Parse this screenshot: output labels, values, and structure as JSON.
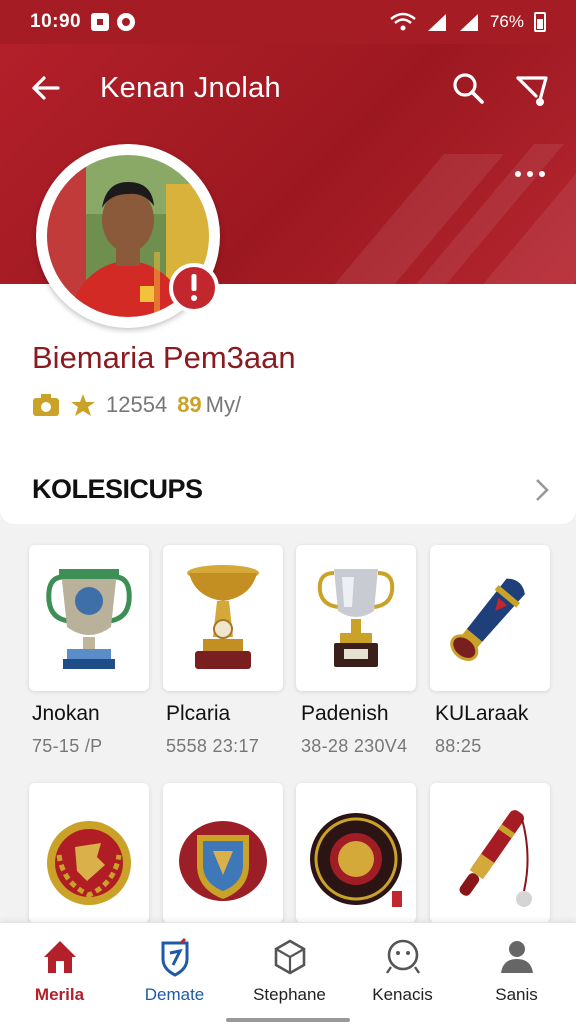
{
  "status_bar": {
    "time": "10:90",
    "battery": "76%"
  },
  "header": {
    "title": "Kenan Jnolah",
    "colors": {
      "primary": "#a51c24",
      "accent_gold": "#c9a227"
    },
    "icons": [
      "back-arrow-icon",
      "search-icon",
      "share-icon",
      "more-icon"
    ]
  },
  "profile": {
    "name": "Biemaria Pem3aan",
    "points": "12554",
    "count": "89",
    "count_unit": "My/"
  },
  "collection": {
    "title": "KOLESICUPS",
    "items": [
      {
        "name": "Jnokan",
        "meta": "75-15 /P",
        "icon": "green-trophy-icon"
      },
      {
        "name": "Plcaria",
        "meta": "5558 23:17",
        "icon": "gold-trophy-icon"
      },
      {
        "name": "Padenish",
        "meta": "38-28 230V4",
        "icon": "silver-cup-icon"
      },
      {
        "name": "KULaraak",
        "meta": "88:25",
        "icon": "horn-trophy-icon"
      },
      {
        "name": "",
        "meta": "",
        "icon": "laurel-medal-icon"
      },
      {
        "name": "",
        "meta": "",
        "icon": "shield-crest-icon"
      },
      {
        "name": "",
        "meta": "",
        "icon": "round-medal-icon"
      },
      {
        "name": "",
        "meta": "",
        "icon": "baton-icon"
      }
    ]
  },
  "bottom_nav": [
    {
      "label": "Merila",
      "icon": "home-icon",
      "active": true
    },
    {
      "label": "Demate",
      "icon": "shield-badge-icon",
      "active": false
    },
    {
      "label": "Stephane",
      "icon": "box-icon",
      "active": false
    },
    {
      "label": "Kenacis",
      "icon": "face-icon",
      "active": false
    },
    {
      "label": "Sanis",
      "icon": "person-icon",
      "active": false
    }
  ]
}
